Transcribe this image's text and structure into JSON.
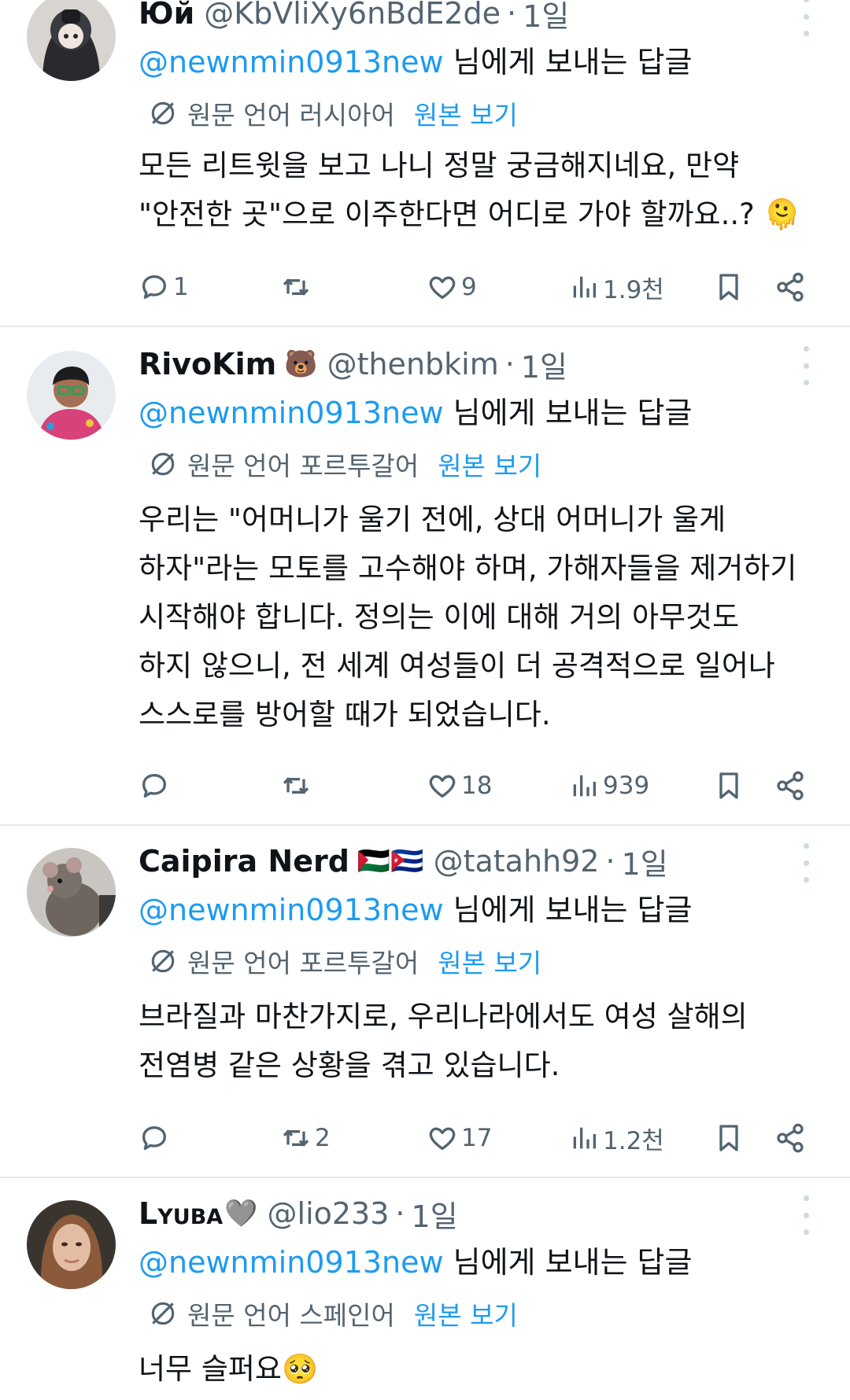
{
  "reply_prefix_suffix": " 님에게 보내는 답글",
  "tweets": [
    {
      "name": "Юй",
      "emoji": "",
      "handle": "@KbVliXy6nBdE2de",
      "time": "1일",
      "reply_to": "@newnmin0913new",
      "translation": {
        "label": "원문 언어 러시아어",
        "show_original": "원본 보기"
      },
      "body": [
        "모든 리트윗을 보고 나니 정말 궁금해지네요, 만약",
        "\"안전한 곳\"으로 이주한다면 어디로 가야 할까요..? 🫠"
      ],
      "actions": {
        "replies": "1",
        "retweets": "",
        "likes": "9",
        "views": "1.9천"
      }
    },
    {
      "name": "RivoKim",
      "emoji": "🐻",
      "handle": "@thenbkim",
      "time": "1일",
      "reply_to": "@newnmin0913new",
      "translation": {
        "label": "원문 언어 포르투갈어",
        "show_original": "원본 보기"
      },
      "body": [
        "우리는 \"어머니가 울기 전에, 상대 어머니가 울게",
        "하자\"라는 모토를 고수해야 하며, 가해자들을 제거하기",
        "시작해야 합니다. 정의는 이에 대해 거의 아무것도",
        "하지 않으니, 전 세계 여성들이 더 공격적으로 일어나",
        "스스로를 방어할 때가 되었습니다."
      ],
      "actions": {
        "replies": "",
        "retweets": "",
        "likes": "18",
        "views": "939"
      }
    },
    {
      "name": "Caipira Nerd",
      "emoji": "🇵🇸🇨🇺",
      "handle": "@tatahh92",
      "time": "1일",
      "reply_to": "@newnmin0913new",
      "translation": {
        "label": "원문 언어 포르투갈어",
        "show_original": "원본 보기"
      },
      "body": [
        "브라질과 마찬가지로, 우리나라에서도 여성 살해의",
        "전염병 같은 상황을 겪고 있습니다."
      ],
      "actions": {
        "replies": "",
        "retweets": "2",
        "likes": "17",
        "views": "1.2천"
      }
    },
    {
      "name": "Lyuba",
      "emoji": "🩶",
      "handle": "@lio233",
      "time": "1일",
      "reply_to": "@newnmin0913new",
      "translation": {
        "label": "원문 언어 스페인어",
        "show_original": "원본 보기"
      },
      "body": [
        "너무 슬퍼요🥺"
      ],
      "actions": {
        "replies": "",
        "retweets": "",
        "likes": "",
        "views": ""
      }
    }
  ],
  "icons": {
    "reply": "reply-icon",
    "retweet": "retweet-icon",
    "like": "heart-icon",
    "views": "views-icon",
    "bookmark": "bookmark-icon",
    "share": "share-icon",
    "translate": "translate-icon",
    "more": "more-icon"
  },
  "colors": {
    "link": "#1d9bf0",
    "secondary": "#536471",
    "divider": "#e6e9ec"
  }
}
